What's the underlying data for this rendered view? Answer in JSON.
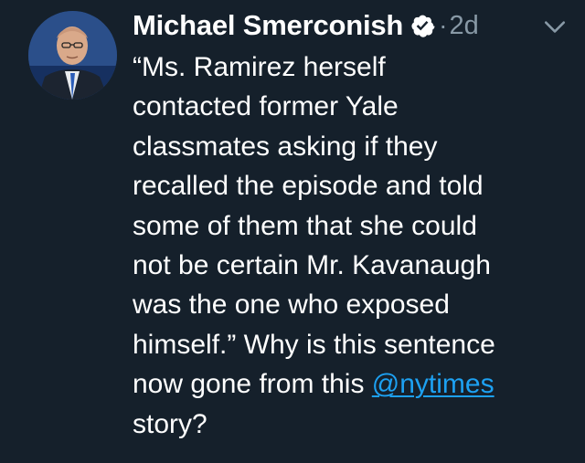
{
  "tweet": {
    "author": {
      "display_name": "Michael Smerconish",
      "verified": true,
      "avatar": "profile-photo"
    },
    "separator": "·",
    "timestamp": "2d",
    "menu_icon": "chevron-down-icon",
    "text_line_1": "“Ms. Ramirez herself",
    "text_line_2": "contacted former Yale",
    "text_line_3": "classmates asking if they",
    "text_line_4": "recalled the episode and told",
    "text_line_5": "some of them that she could",
    "text_line_6": "not be certain Mr. Kavanaugh",
    "text_line_7": "was the one who exposed",
    "text_line_8": "himself.” Why is this sentence",
    "text_line_9_prefix": "now gone from this ",
    "mention": "@nytimes",
    "text_line_10": "story?"
  },
  "colors": {
    "background": "#15202b",
    "text": "#ffffff",
    "secondary_text": "#8899a6",
    "link": "#1da1f2"
  }
}
